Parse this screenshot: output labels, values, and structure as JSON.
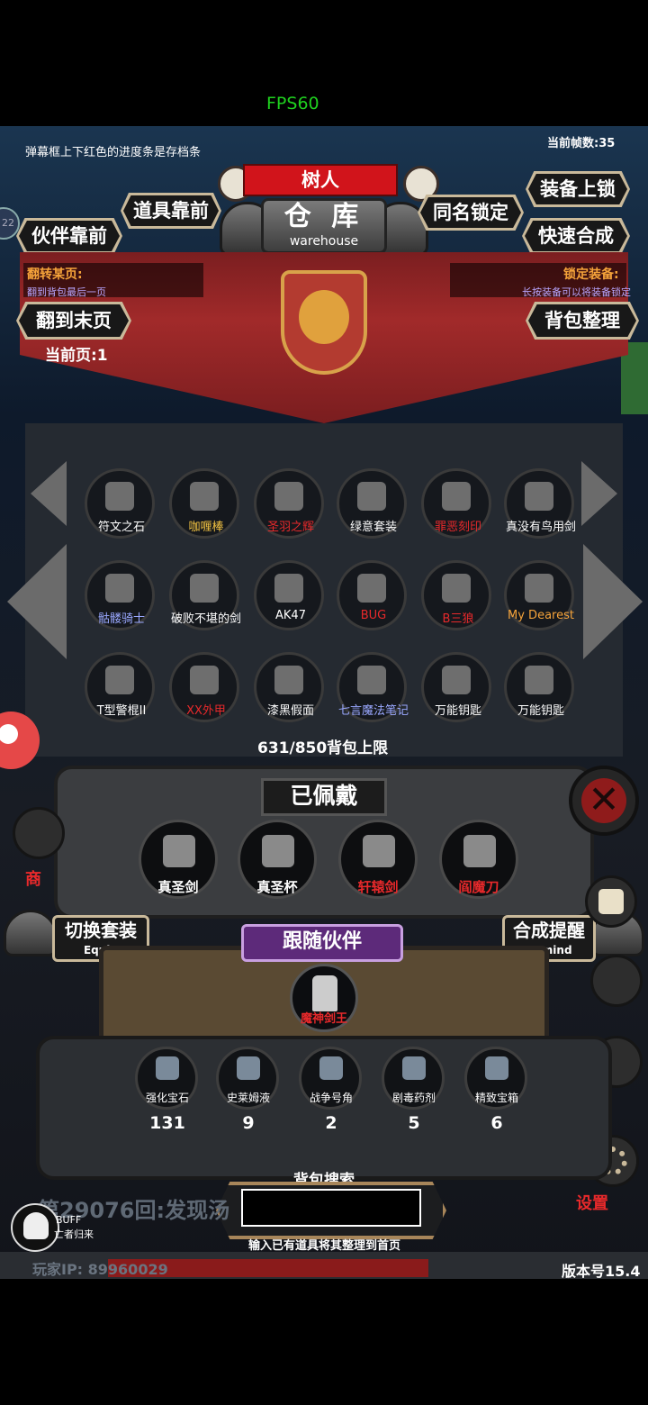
{
  "status": {
    "fps": "FPS60"
  },
  "top": {
    "save_hint": "弹幕框上下红色的进度条是存档条",
    "frame_counter": "当前帧数:35",
    "character_name": "树人",
    "warehouse_cn": "仓 库",
    "warehouse_en": "warehouse",
    "btn_item_front": "道具靠前",
    "btn_companion_front": "伙伴靠前",
    "btn_same_name_lock": "同名锁定",
    "btn_equip_lock": "装备上锁",
    "btn_quick_merge": "快速合成"
  },
  "curtain": {
    "flip_title": "翻转某页:",
    "flip_desc": "翻到背包最后一页",
    "lock_title": "锁定装备:",
    "lock_desc": "长按装备可以将装备锁定",
    "btn_last_page": "翻到末页",
    "btn_sort": "背包整理",
    "current_page": "当前页:1"
  },
  "inventory": {
    "rows": [
      [
        {
          "label": "符文之石",
          "icon": "rune-stone-icon",
          "color": "#ffffff"
        },
        {
          "label": "咖喱棒",
          "icon": "golden-sword-icon",
          "color": "#f5c542"
        },
        {
          "label": "圣羽之辉",
          "icon": "silver-wings-icon",
          "color": "#e8292b"
        },
        {
          "label": "绿意套装",
          "icon": "green-armor-icon",
          "color": "#ffffff"
        },
        {
          "label": "罪恶刻印",
          "icon": "demon-seal-icon",
          "color": "#e8292b"
        },
        {
          "label": "真没有鸟用剑",
          "icon": "rose-sword-icon",
          "color": "#ffffff"
        }
      ],
      [
        {
          "label": "骷髅骑士",
          "icon": "skeleton-knight-icon",
          "color": "#9aa8ff"
        },
        {
          "label": "破败不堪的剑",
          "icon": "broken-sword-icon",
          "color": "#ffffff"
        },
        {
          "label": "AK47",
          "icon": "rifle-icon",
          "color": "#ffffff"
        },
        {
          "label": "BUG",
          "icon": "bug-question-icon",
          "color": "#e8292b"
        },
        {
          "label": "B三狼",
          "icon": "green-wolf-icon",
          "color": "#e8292b"
        },
        {
          "label": "My Dearest",
          "icon": "dark-orb-icon",
          "color": "#f5a33a"
        }
      ],
      [
        {
          "label": "T型警棍II",
          "icon": "baton-icon",
          "color": "#ffffff"
        },
        {
          "label": "XX外甲",
          "icon": "purple-mech-icon",
          "color": "#e8292b"
        },
        {
          "label": "漆黑假面",
          "icon": "black-mask-icon",
          "color": "#ffffff"
        },
        {
          "label": "七言魔法笔记",
          "icon": "spellbook-icon",
          "color": "#9aa8ff"
        },
        {
          "label": "万能钥匙",
          "icon": "golden-key-icon",
          "color": "#ffffff"
        },
        {
          "label": "万能钥匙",
          "icon": "golden-key-icon",
          "color": "#ffffff"
        }
      ]
    ],
    "capacity_text": "631/850背包上限"
  },
  "equipped": {
    "title": "已佩戴",
    "items": [
      {
        "label": "真圣剑",
        "icon": "holy-sword-icon",
        "color": "#ffffff"
      },
      {
        "label": "真圣杯",
        "icon": "holy-grail-icon",
        "color": "#ffffff"
      },
      {
        "label": "轩辕剑",
        "icon": "xuanyuan-sword-icon",
        "color": "#e8292b"
      },
      {
        "label": "阎魔刀",
        "icon": "demon-blade-icon",
        "color": "#e8292b"
      }
    ],
    "btn_switch_set": "切换套装",
    "btn_switch_set_en": "Equip",
    "btn_merge_remind": "合成提醒",
    "btn_merge_remind_en": "Remind"
  },
  "companion": {
    "title": "跟随伙伴",
    "name": "魔神剑王"
  },
  "consumables": [
    {
      "label": "强化宝石",
      "icon": "green-gem-icon",
      "count": "131"
    },
    {
      "label": "史莱姆液",
      "icon": "slime-potion-icon",
      "count": "9"
    },
    {
      "label": "战争号角",
      "icon": "war-horn-icon",
      "count": "2"
    },
    {
      "label": "剧毒药剂",
      "icon": "poison-flask-icon",
      "count": "5"
    },
    {
      "label": "精致宝箱",
      "icon": "treasure-chest-icon",
      "count": "6"
    }
  ],
  "search": {
    "title": "背包搜索",
    "placeholder": "",
    "hint": "输入已有道具将其整理到首页"
  },
  "footer": {
    "round_text": "第29076回:发现汤",
    "buff_label": "BUFF",
    "buff_sub": "亡者归来",
    "player_ip": "玩家IP:  89960029",
    "version": "版本号15.4",
    "settings": "设置",
    "shop_partial": "商",
    "avatar_number": "22"
  },
  "colors": {
    "fps_green": "#1fd11f",
    "banner_red": "#d1141b",
    "curtain_red": "#a12a2a",
    "orange_title": "#f5a33a",
    "purple_desc": "#b8a6ff"
  }
}
